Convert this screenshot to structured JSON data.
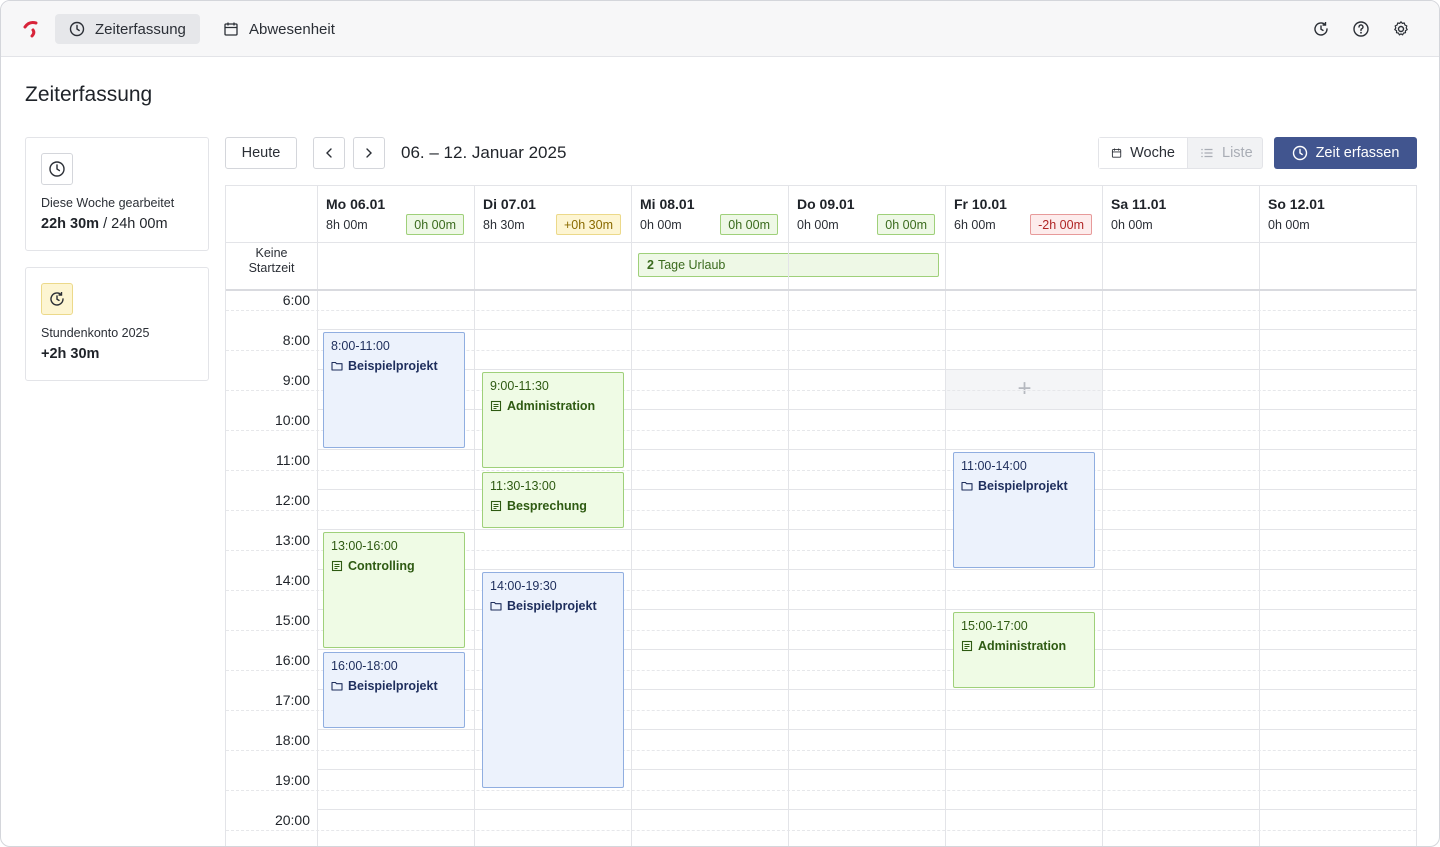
{
  "nav": {
    "tabs": [
      {
        "label": "Zeiterfassung",
        "icon": "clock-icon",
        "active": true
      },
      {
        "label": "Abwesenheit",
        "icon": "calendar-icon",
        "active": false
      }
    ],
    "right_icons": [
      "history-icon",
      "help-icon",
      "settings-icon"
    ]
  },
  "page": {
    "title": "Zeiterfassung"
  },
  "stats": [
    {
      "icon": "clock-icon",
      "label": "Diese Woche gearbeitet",
      "value_main": "22h 30m",
      "value_sep": " / ",
      "value_rest": "24h 00m"
    },
    {
      "icon": "history-icon",
      "label": "Stundenkonto 2025",
      "value_main": "+2h 30m"
    }
  ],
  "toolbar": {
    "today": "Heute",
    "prev_icon": "chevron-left-icon",
    "next_icon": "chevron-right-icon",
    "range": "06. – 12. Januar 2025",
    "view_week": "Woche",
    "view_list": "Liste",
    "add_time": "Zeit erfassen"
  },
  "calendar": {
    "no_start_line1": "Keine",
    "no_start_line2": "Startzeit",
    "days": [
      {
        "name": "Mo 06.01",
        "hours": "8h 00m",
        "delta": "0h 00m",
        "delta_status": "green"
      },
      {
        "name": "Di 07.01",
        "hours": "8h 30m",
        "delta": "+0h 30m",
        "delta_status": "yellow"
      },
      {
        "name": "Mi 08.01",
        "hours": "0h 00m",
        "delta": "0h 00m",
        "delta_status": "green"
      },
      {
        "name": "Do 09.01",
        "hours": "0h 00m",
        "delta": "0h 00m",
        "delta_status": "green"
      },
      {
        "name": "Fr 10.01",
        "hours": "6h 00m",
        "delta": "-2h 00m",
        "delta_status": "red"
      },
      {
        "name": "Sa 11.01",
        "hours": "0h 00m"
      },
      {
        "name": "So 12.01",
        "hours": "0h 00m"
      }
    ],
    "vacation": {
      "count": "2",
      "text": "Tage Urlaub"
    },
    "hours": [
      "6:00",
      "8:00",
      "9:00",
      "10:00",
      "11:00",
      "12:00",
      "13:00",
      "14:00",
      "15:00",
      "16:00",
      "17:00",
      "18:00",
      "19:00",
      "20:00"
    ],
    "add_slot_label": "+",
    "events": [
      {
        "day": 0,
        "start": 8,
        "end": 11,
        "time": "8:00-11:00",
        "project": "Beispielprojekt",
        "type": "project",
        "color": "blue"
      },
      {
        "day": 0,
        "start": 13,
        "end": 16,
        "time": "13:00-16:00",
        "project": "Controlling",
        "type": "task",
        "color": "green"
      },
      {
        "day": 0,
        "start": 16,
        "end": 18,
        "time": "16:00-18:00",
        "project": "Beispielprojekt",
        "type": "project",
        "color": "blue"
      },
      {
        "day": 1,
        "start": 9,
        "end": 11.5,
        "time": "9:00-11:30",
        "project": "Administration",
        "type": "task",
        "color": "green"
      },
      {
        "day": 1,
        "start": 11.5,
        "end": 13,
        "time": "11:30-13:00",
        "project": "Besprechung",
        "type": "task",
        "color": "green"
      },
      {
        "day": 1,
        "start": 14,
        "end": 19.5,
        "time": "14:00-19:30",
        "project": "Beispielprojekt",
        "type": "project",
        "color": "blue"
      },
      {
        "day": 4,
        "start": 11,
        "end": 14,
        "time": "11:00-14:00",
        "project": "Beispielprojekt",
        "type": "project",
        "color": "blue"
      },
      {
        "day": 4,
        "start": 15,
        "end": 17,
        "time": "15:00-17:00",
        "project": "Administration",
        "type": "task",
        "color": "green"
      }
    ]
  }
}
